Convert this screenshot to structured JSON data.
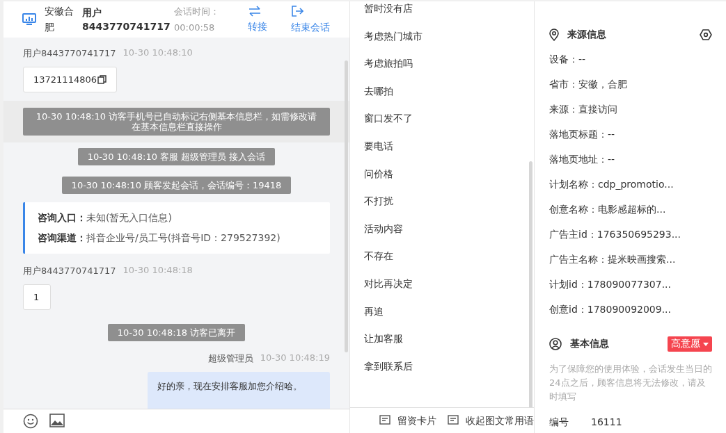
{
  "header": {
    "location": "安徽合肥",
    "user": "用户8443770741717",
    "duration_label": "会话时间：",
    "duration": "00:00:58",
    "actions": [
      {
        "kind": "transfer",
        "label": "转接"
      },
      {
        "kind": "end",
        "label": "结束会话"
      }
    ]
  },
  "messages": [
    {
      "kind": "visitor",
      "name": "用户8443770741717",
      "time": "10-30 10:48:10",
      "text": "13721114806",
      "copyable": true
    },
    {
      "kind": "system",
      "text": "10-30 10:48:10 访客手机号已自动标记右侧基本信息栏，如需修改请在基本信息栏直接操作",
      "highlighted": true
    },
    {
      "kind": "system",
      "text": "10-30 10:48:10 客服 超级管理员 接入会话",
      "highlighted": false
    },
    {
      "kind": "system",
      "text": "10-30 10:48:10 顾客发起会话，会话编号：19418",
      "highlighted": false
    },
    {
      "kind": "card",
      "rows": [
        {
          "label": "咨询入口：",
          "value": "未知(暂无入口信息)"
        },
        {
          "label": "咨询渠道：",
          "value": "抖音企业号/员工号(抖音号ID：279527392)"
        }
      ]
    },
    {
      "kind": "visitor",
      "name": "用户8443770741717",
      "time": "10-30 10:48:18",
      "text": "1",
      "copyable": false
    },
    {
      "kind": "system",
      "text": "10-30 10:48:18 访客已离开",
      "highlighted": false
    },
    {
      "kind": "agent",
      "name": "超级管理员",
      "time": "10-30 10:48:19",
      "text": "好的亲，现在安排客服加您介绍哈。"
    }
  ],
  "phrases": [
    "暂时没有店",
    "考虑热门城市",
    "考虑旅拍吗",
    "去哪拍",
    "窗口发不了",
    "要电话",
    "问价格",
    "不打扰",
    "活动内容",
    "不存在",
    "对比再决定",
    "再追",
    "让加客服",
    "拿到联系后"
  ],
  "bottom_actions": [
    "留资卡片",
    "收起图文常用语"
  ],
  "source": {
    "title": "来源信息",
    "fields": [
      "设备：--",
      "省市：安徽，合肥",
      "来源：直接访问",
      "落地页标题：--",
      "落地页地址：--",
      "计划名称：cdp_promotio...",
      "创意名称：电影感超标的...",
      "广告主id：176350695293...",
      "广告主名称：提米映画搜索...",
      "计划id：178090077307...",
      "创意id：178090092009..."
    ]
  },
  "basic": {
    "title": "基本信息",
    "tag": "高意愿",
    "note": "为了保障您的使用体验，会话发生当日的24点之后，顾客信息将无法修改，请及时填写",
    "fields": [
      {
        "label": "编号",
        "value": "16111"
      }
    ]
  }
}
